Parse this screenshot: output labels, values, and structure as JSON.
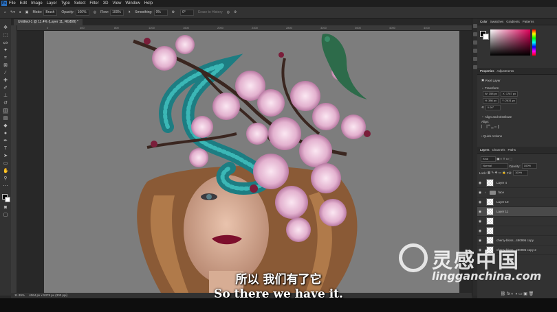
{
  "app": {
    "logo": "Ps"
  },
  "menu": [
    "File",
    "Edit",
    "Image",
    "Layer",
    "Type",
    "Select",
    "Filter",
    "3D",
    "View",
    "Window",
    "Help"
  ],
  "options": {
    "mode_label": "Mode:",
    "mode_value": "Brush",
    "opacity_label": "Opacity:",
    "opacity_value": "100%",
    "flow_label": "Flow:",
    "flow_value": "100%",
    "smoothing_label": "Smoothing:",
    "smoothing_value": "0%",
    "angle_value": "0°",
    "erase_history": "Erase to History"
  },
  "document": {
    "tab_title": "Untitled-1 @ 11.4% (Layer 11, RGB/8) *",
    "ruler_ticks": [
      "0",
      "400",
      "800",
      "1200",
      "1600",
      "2000",
      "2400",
      "2800",
      "3200",
      "3600",
      "4000",
      "4400"
    ]
  },
  "status": {
    "zoom": "11.39%",
    "doc_size": "4064 px x 5378 px (300 ppi)"
  },
  "panels": {
    "color_tabs": [
      "Color",
      "Swatches",
      "Gradients",
      "Patterns"
    ],
    "props_tabs": [
      "Properties",
      "Adjustments"
    ],
    "pixel_layer": "Pixel Layer",
    "transform_title": "Transform",
    "transform": {
      "w": "W: 358 px",
      "h": "H: 386 px",
      "x": "X: 1767 px",
      "y": "Y: 2631 px",
      "angle": "0.00°"
    },
    "align_title": "Align and Distribute",
    "align_label": "Align:",
    "quick_actions": "Quick Actions",
    "layers_tabs": [
      "Layers",
      "Channels",
      "Paths"
    ],
    "kind_label": "Kind",
    "blend_mode": "Normal",
    "opacity_label": "Opacity:",
    "opacity_value": "100%",
    "lock_label": "Lock:",
    "fill_label": "Fill:",
    "fill_value": "100%",
    "layers": [
      {
        "name": "Layer 4",
        "type": "pixel"
      },
      {
        "name": "face",
        "type": "group"
      },
      {
        "name": "Layer 10",
        "type": "pixel"
      },
      {
        "name": "Layer 11",
        "type": "pixel",
        "selected": true
      },
      {
        "name": "",
        "type": "pixel"
      },
      {
        "name": "",
        "type": "pixel"
      },
      {
        "name": "cherry-bloss...490996 copy",
        "type": "pixel"
      },
      {
        "name": "cherry-bloss...490996 copy 2",
        "type": "pixel"
      }
    ]
  },
  "subtitles": {
    "chinese": "所以 我们有了它",
    "english": "So there we have it."
  },
  "watermark": {
    "text": "灵感中国",
    "url": "lingganchina.com"
  },
  "colors": {
    "chrome_dark": "#1e1e1e",
    "panel": "#323232",
    "canvas_bg": "#7d7d7d",
    "fg_swatch": "#000000",
    "accent_pink": "#e0005a"
  }
}
